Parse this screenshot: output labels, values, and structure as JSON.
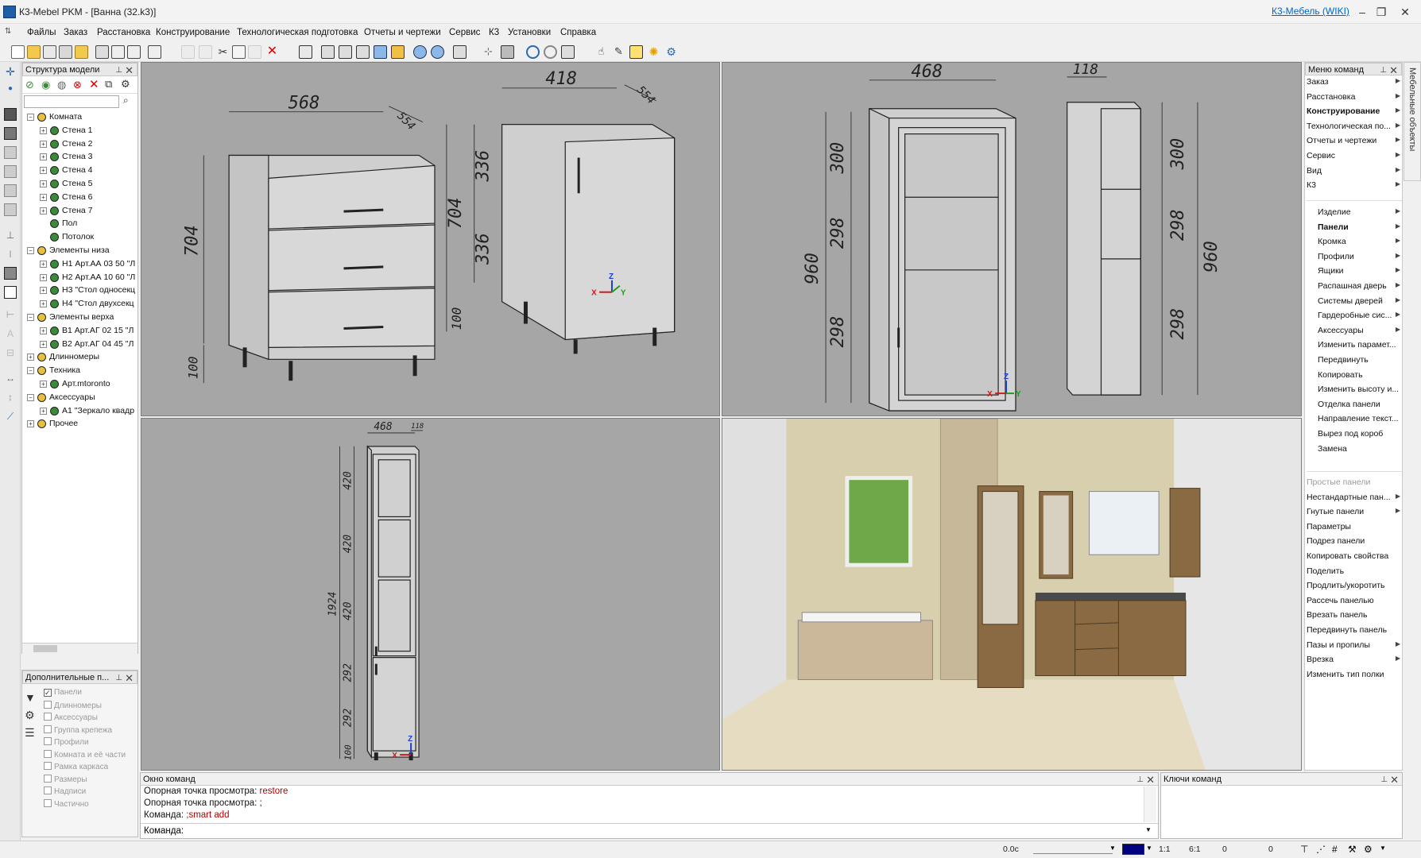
{
  "window": {
    "title": "К3-Mebel PKM - [Ванна (32.k3)]",
    "wiki_link": "К3-Мебель (WIKI)",
    "minimize": "–",
    "restore": "❐",
    "close": "✕"
  },
  "menu": [
    "Файлы",
    "Заказ",
    "Расстановка",
    "Конструирование",
    "Технологическая подготовка",
    "Отчеты и чертежи",
    "Сервис",
    "К3",
    "Установки",
    "Справка"
  ],
  "tree_panel": {
    "title": "Структура модели",
    "pin": "⊥",
    "close": "✕",
    "search_placeholder": "",
    "rows": [
      {
        "label": "Комната",
        "level": 0,
        "exp": "−"
      },
      {
        "label": "Стена 1",
        "level": 1,
        "exp": "+"
      },
      {
        "label": "Стена 2",
        "level": 1,
        "exp": "+"
      },
      {
        "label": "Стена 3",
        "level": 1,
        "exp": "+"
      },
      {
        "label": "Стена 4",
        "level": 1,
        "exp": "+"
      },
      {
        "label": "Стена 5",
        "level": 1,
        "exp": "+"
      },
      {
        "label": "Стена 6",
        "level": 1,
        "exp": "+"
      },
      {
        "label": "Стена 7",
        "level": 1,
        "exp": "+"
      },
      {
        "label": "Пол",
        "level": 1,
        "exp": ""
      },
      {
        "label": "Потолок",
        "level": 1,
        "exp": ""
      },
      {
        "label": "Элементы низа",
        "level": 0,
        "exp": "−"
      },
      {
        "label": "Н1 Арт.АА 03 50 \"Л",
        "level": 1,
        "exp": "+"
      },
      {
        "label": "Н2 Арт.АА 10 60 \"Л",
        "level": 1,
        "exp": "+"
      },
      {
        "label": "Н3 \"Стол односекц",
        "level": 1,
        "exp": "+"
      },
      {
        "label": "Н4 \"Стол двухсекц",
        "level": 1,
        "exp": "+"
      },
      {
        "label": "Элементы верха",
        "level": 0,
        "exp": "−"
      },
      {
        "label": "В1 Арт.АГ 02 15 \"Л",
        "level": 1,
        "exp": "+"
      },
      {
        "label": "В2 Арт.АГ 04 45 \"Л",
        "level": 1,
        "exp": "+"
      },
      {
        "label": "Длинномеры",
        "level": 0,
        "exp": "+"
      },
      {
        "label": "Техника",
        "level": 0,
        "exp": "−"
      },
      {
        "label": "Арт.mtoronto",
        "level": 1,
        "exp": "+"
      },
      {
        "label": "Аксессуары",
        "level": 0,
        "exp": "−"
      },
      {
        "label": "А1 \"Зеркало квадр",
        "level": 1,
        "exp": "+"
      },
      {
        "label": "Прочее",
        "level": 0,
        "exp": "+"
      }
    ]
  },
  "extra_panel": {
    "title": "Дополнительные п...",
    "items": [
      {
        "label": "Панели",
        "checked": true
      },
      {
        "label": "Длинномеры",
        "checked": false
      },
      {
        "label": "Аксессуары",
        "checked": false
      },
      {
        "label": "Группа крепежа",
        "checked": false
      },
      {
        "label": "Профили",
        "checked": false
      },
      {
        "label": "Комната и её части",
        "checked": false
      },
      {
        "label": "Рамка каркаса",
        "checked": false
      },
      {
        "label": "Размеры",
        "checked": false
      },
      {
        "label": "Надписи",
        "checked": false
      },
      {
        "label": "Частично",
        "checked": false
      }
    ]
  },
  "viewport1": {
    "dims": [
      "568",
      "554",
      "704",
      "100",
      "418",
      "554",
      "336",
      "336",
      "704",
      "100"
    ],
    "axes": [
      "Z",
      "X",
      "Y"
    ]
  },
  "viewport2": {
    "dims": [
      "468",
      "118",
      "300",
      "298",
      "298",
      "960",
      "300",
      "298",
      "298",
      "960"
    ],
    "axes": [
      "Z",
      "X",
      "Y"
    ]
  },
  "viewport3": {
    "dims": [
      "468",
      "118",
      "420",
      "420",
      "420",
      "292",
      "292",
      "100",
      "1924"
    ],
    "axes": [
      "Z",
      "X"
    ]
  },
  "command_menu": {
    "title": "Меню команд",
    "side_tab": "Мебельные объекты",
    "items": [
      {
        "label": "Заказ",
        "arrow": true,
        "style": ""
      },
      {
        "label": "Расстановка",
        "arrow": true,
        "style": ""
      },
      {
        "label": "Конструирование",
        "arrow": true,
        "style": "bold"
      },
      {
        "label": "Технологическая по...",
        "arrow": true,
        "style": ""
      },
      {
        "label": "Отчеты и чертежи",
        "arrow": true,
        "style": ""
      },
      {
        "label": "Сервис",
        "arrow": true,
        "style": ""
      },
      {
        "label": "Вид",
        "arrow": true,
        "style": ""
      },
      {
        "label": "К3",
        "arrow": true,
        "style": ""
      }
    ],
    "sub_items": [
      {
        "label": "Изделие",
        "arrow": true,
        "style": ""
      },
      {
        "label": "Панели",
        "arrow": true,
        "style": "bold"
      },
      {
        "label": "Кромка",
        "arrow": true,
        "style": ""
      },
      {
        "label": "Профили",
        "arrow": true,
        "style": ""
      },
      {
        "label": "Ящики",
        "arrow": true,
        "style": ""
      },
      {
        "label": "Распашная дверь",
        "arrow": true,
        "style": ""
      },
      {
        "label": "Системы дверей",
        "arrow": true,
        "style": ""
      },
      {
        "label": "Гардеробные сис...",
        "arrow": true,
        "style": ""
      },
      {
        "label": "Аксессуары",
        "arrow": true,
        "style": ""
      },
      {
        "label": "Изменить парамет...",
        "arrow": false,
        "style": ""
      },
      {
        "label": "Передвинуть",
        "arrow": false,
        "style": ""
      },
      {
        "label": "Копировать",
        "arrow": false,
        "style": ""
      },
      {
        "label": "Изменить высоту и...",
        "arrow": false,
        "style": ""
      },
      {
        "label": "Отделка панели",
        "arrow": false,
        "style": ""
      },
      {
        "label": "Направление текст...",
        "arrow": false,
        "style": ""
      },
      {
        "label": "Вырез под короб",
        "arrow": false,
        "style": ""
      },
      {
        "label": "Замена",
        "arrow": false,
        "style": ""
      }
    ],
    "panel_items": [
      {
        "label": "Простые панели",
        "arrow": false,
        "style": "dis"
      },
      {
        "label": "Нестандартные пан...",
        "arrow": true,
        "style": ""
      },
      {
        "label": "Гнутые панели",
        "arrow": true,
        "style": ""
      },
      {
        "label": "Параметры",
        "arrow": false,
        "style": ""
      },
      {
        "label": "Подрез панели",
        "arrow": false,
        "style": ""
      },
      {
        "label": "Копировать свойства",
        "arrow": false,
        "style": ""
      },
      {
        "label": "Поделить",
        "arrow": false,
        "style": ""
      },
      {
        "label": "Продлить/укоротить",
        "arrow": false,
        "style": ""
      },
      {
        "label": "Рассечь панелью",
        "arrow": false,
        "style": ""
      },
      {
        "label": "Врезать панель",
        "arrow": false,
        "style": ""
      },
      {
        "label": "Передвинуть панель",
        "arrow": false,
        "style": ""
      },
      {
        "label": "Пазы и пропилы",
        "arrow": true,
        "style": ""
      },
      {
        "label": "Врезка",
        "arrow": true,
        "style": ""
      },
      {
        "label": "Изменить тип полки",
        "arrow": false,
        "style": ""
      }
    ]
  },
  "command_window": {
    "title": "Окно команд",
    "lines": [
      {
        "prefix": "Опорная точка просмотра: ",
        "value": "restore"
      },
      {
        "prefix": "Опорная точка просмотра: ;",
        "value": ""
      },
      {
        "prefix": "Команда: ",
        "value": ";smart add"
      }
    ],
    "input_label": "Команда:",
    "input_value": ""
  },
  "keys_window": {
    "title": "Ключи команд"
  },
  "status": {
    "time": "0.0c",
    "scale1": "1:1",
    "scale2": "6:1",
    "coord1": "0",
    "coord2": "0",
    "color_swatch": "#000080"
  }
}
